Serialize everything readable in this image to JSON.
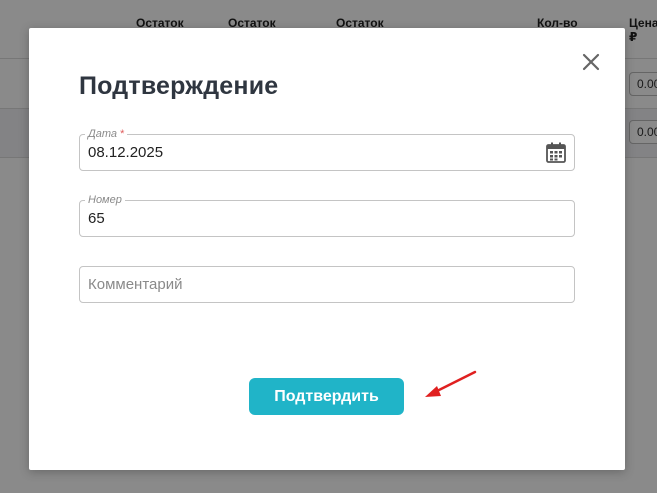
{
  "background_table": {
    "headers": [
      "Остаток",
      "Остаток",
      "Остаток",
      "Кол-во",
      "Цена, ₽"
    ],
    "row_values": [
      "0.00",
      "0.00"
    ]
  },
  "modal": {
    "title": "Подтверждение",
    "close_icon": "close-icon",
    "fields": {
      "date": {
        "label": "Дата",
        "required_mark": "*",
        "value": "08.12.2025",
        "icon": "calendar-icon"
      },
      "number": {
        "label": "Номер",
        "value": "65"
      },
      "comment": {
        "placeholder": "Комментарий",
        "value": ""
      }
    },
    "confirm_label": "Подтвердить"
  },
  "colors": {
    "accent": "#20b4c8",
    "title": "#2f3640",
    "annotation_arrow": "#e02020"
  }
}
